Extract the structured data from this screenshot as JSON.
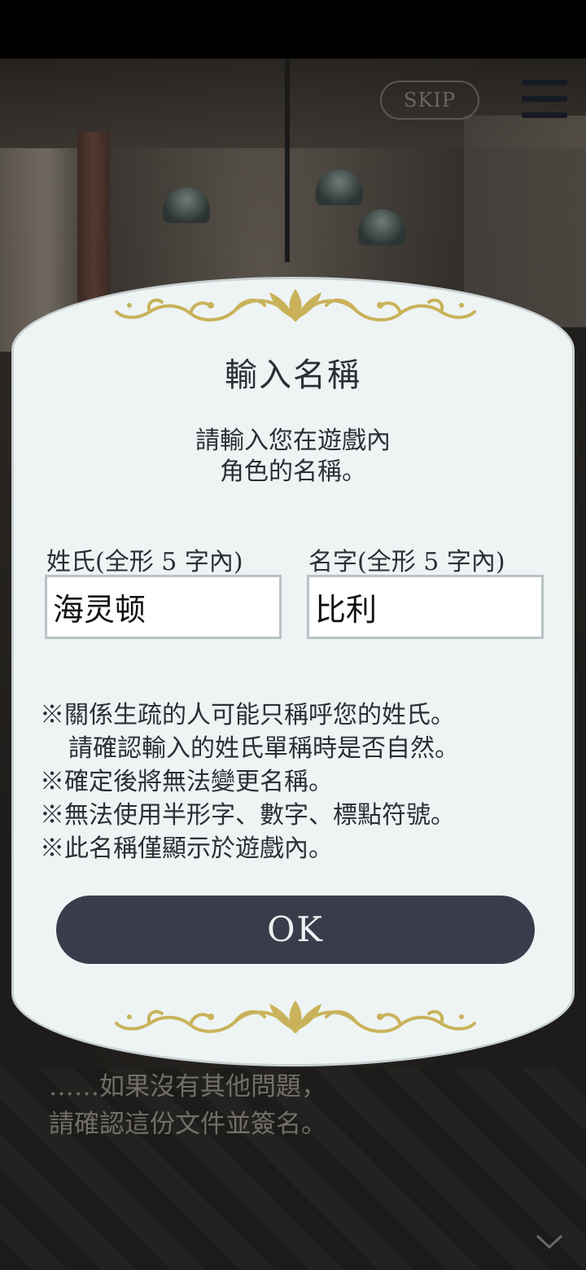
{
  "header": {
    "skip_label": "SKIP"
  },
  "modal": {
    "title": "輸入名稱",
    "description": [
      "請輸入您在遊戲內",
      "角色的名稱。"
    ],
    "surname": {
      "label": "姓氏(全形 5 字內)",
      "value": "海灵顿"
    },
    "given_name": {
      "label": "名字(全形 5 字內)",
      "value": "比利"
    },
    "notes": [
      "※關係生疏的人可能只稱呼您的姓氏。",
      "請確認輸入的姓氏單稱時是否自然。",
      "※確定後將無法變更名稱。",
      "※無法使用半形字、數字、標點符號。",
      "※此名稱僅顯示於遊戲內。"
    ],
    "ok_label": "OK"
  },
  "story": {
    "lines": [
      "……如果沒有其他問題，",
      "請確認這份文件並簽名。"
    ]
  },
  "colors": {
    "modal_bg": "#eef4f4",
    "ornament_gold": "#c9b25a",
    "ok_button": "#3b3c4b",
    "text_dark": "#2b2f33"
  },
  "icons": {
    "menu": "hamburger-menu-icon",
    "next": "chevron-down-icon",
    "ornament": "gold-flourish-ornament"
  }
}
